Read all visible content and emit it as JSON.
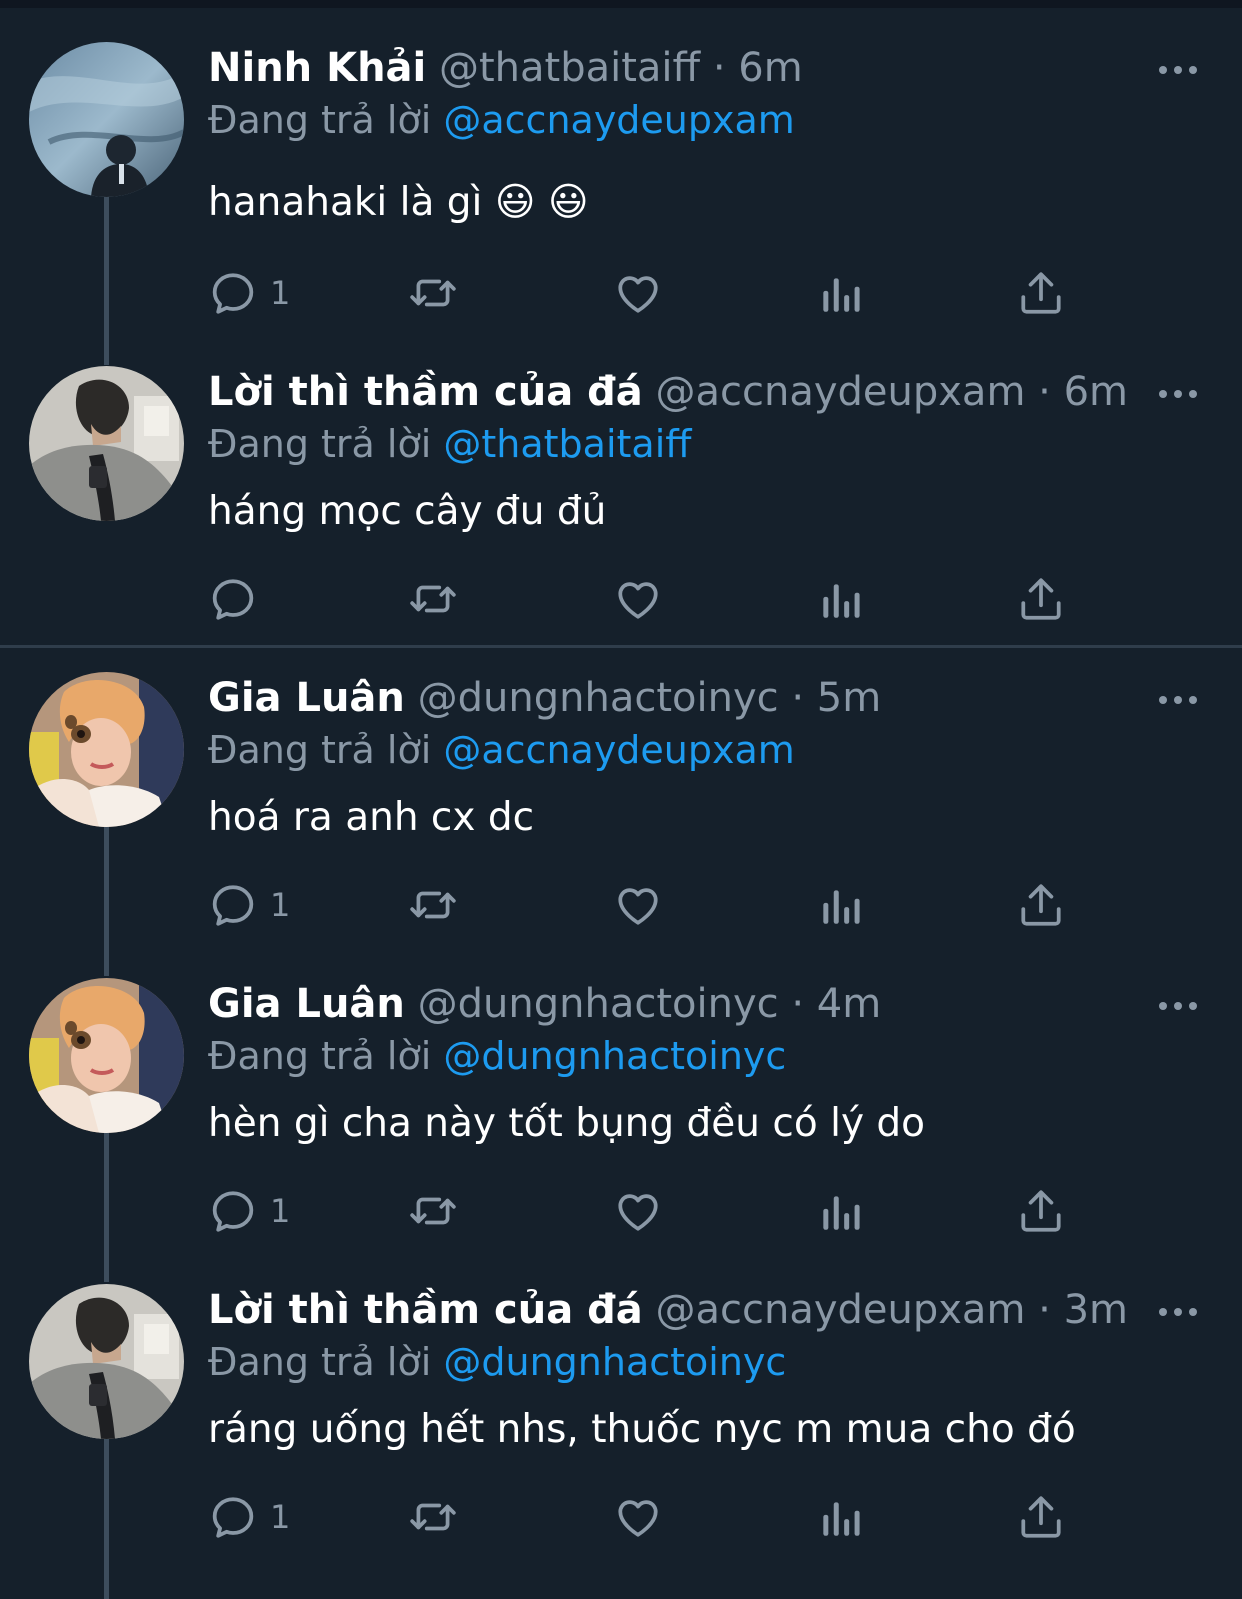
{
  "labels": {
    "replying_to": "Đang trả lời"
  },
  "colors": {
    "background": "#15202b",
    "name": "#ffffff",
    "secondary_text": "#8a98a6",
    "mention": "#1d9bf0",
    "thread_line": "#3d4d5d",
    "divider": "#2f3d4b"
  },
  "tweets": [
    {
      "name": "Ninh Khải",
      "handle": "@thatbaitaiff",
      "time": "6m",
      "replying_to_handle": "@accnaydeupxam",
      "text": "hanahaki là gì 😃 😃",
      "reply_count": "1",
      "avatar_icon": "avatar-photo-aquarium"
    },
    {
      "name": "Lời thì thầm của đá",
      "handle": "@accnaydeupxam",
      "time": "6m",
      "replying_to_handle": "@thatbaitaiff",
      "text": "háng mọc cây đu đủ",
      "reply_count": "",
      "avatar_icon": "avatar-photo-backpack"
    },
    {
      "name": "Gia Luân",
      "handle": "@dungnhactoinyc",
      "time": "5m",
      "replying_to_handle": "@accnaydeupxam",
      "text": "hoá ra anh cx dc",
      "reply_count": "1",
      "avatar_icon": "avatar-photo-selfie"
    },
    {
      "name": "Gia Luân",
      "handle": "@dungnhactoinyc",
      "time": "4m",
      "replying_to_handle": "@dungnhactoinyc",
      "text": "hèn gì cha này tốt bụng đều có lý do",
      "reply_count": "1",
      "avatar_icon": "avatar-photo-selfie"
    },
    {
      "name": "Lời thì thầm của đá",
      "handle": "@accnaydeupxam",
      "time": "3m",
      "replying_to_handle": "@dungnhactoinyc",
      "text": "ráng uống hết nhs, thuốc nyc m mua cho đó",
      "reply_count": "1",
      "avatar_icon": "avatar-photo-backpack"
    }
  ]
}
